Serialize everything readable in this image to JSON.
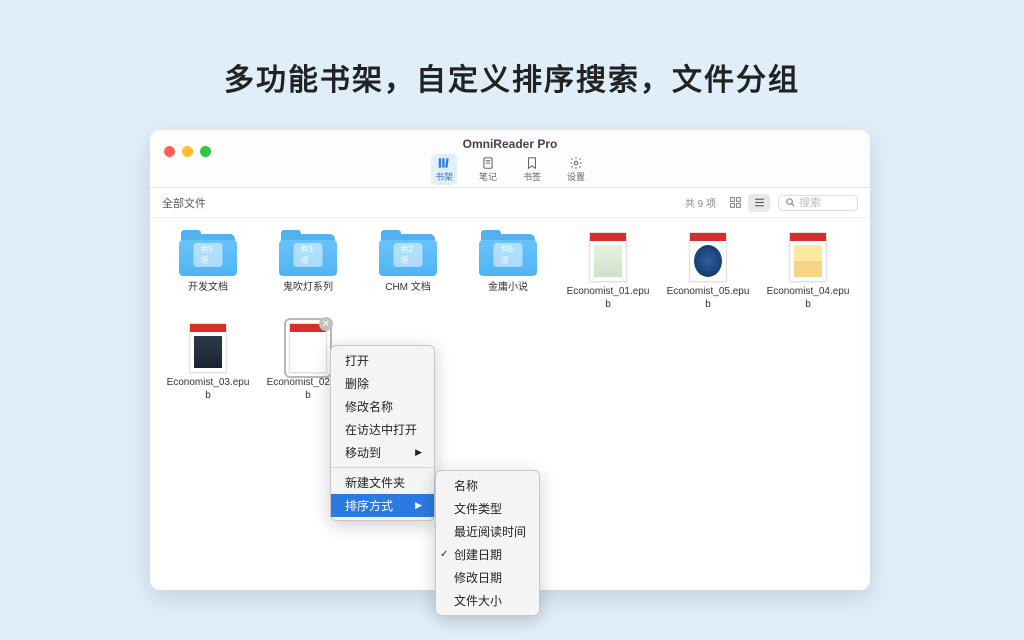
{
  "marketing_title": "多功能书架，自定义排序搜索，文件分组",
  "window_title": "OmniReader Pro",
  "tabs": {
    "bookshelf": "书架",
    "notes": "笔记",
    "bookmarks": "书签",
    "settings": "设置"
  },
  "subbar": {
    "path": "全部文件",
    "count": "共 9 项",
    "search_placeholder": "搜索"
  },
  "folders": [
    {
      "badge": "共5项",
      "label": "开发文档"
    },
    {
      "badge": "共3项",
      "label": "鬼吹灯系列"
    },
    {
      "badge": "共2项",
      "label": "CHM 文档"
    },
    {
      "badge": "共6项",
      "label": "金庸小说"
    }
  ],
  "books": [
    {
      "label": "Economist_01.epub",
      "illus": "chart"
    },
    {
      "label": "Economist_05.epub",
      "illus": "globe"
    },
    {
      "label": "Economist_04.epub",
      "illus": "beach"
    },
    {
      "label": "Economist_03.epub",
      "illus": "hands"
    },
    {
      "label": "Economist_02.epub",
      "illus": "medicine",
      "selected": true
    }
  ],
  "context_menu": {
    "open": "打开",
    "delete": "删除",
    "rename": "修改名称",
    "reveal": "在访达中打开",
    "move_to": "移动到",
    "new_folder": "新建文件夹",
    "sort_by": "排序方式"
  },
  "sort_submenu": {
    "name": "名称",
    "type": "文件类型",
    "recent": "最近阅读时间",
    "created": "创建日期",
    "modified": "修改日期",
    "size": "文件大小",
    "checked": "created"
  }
}
